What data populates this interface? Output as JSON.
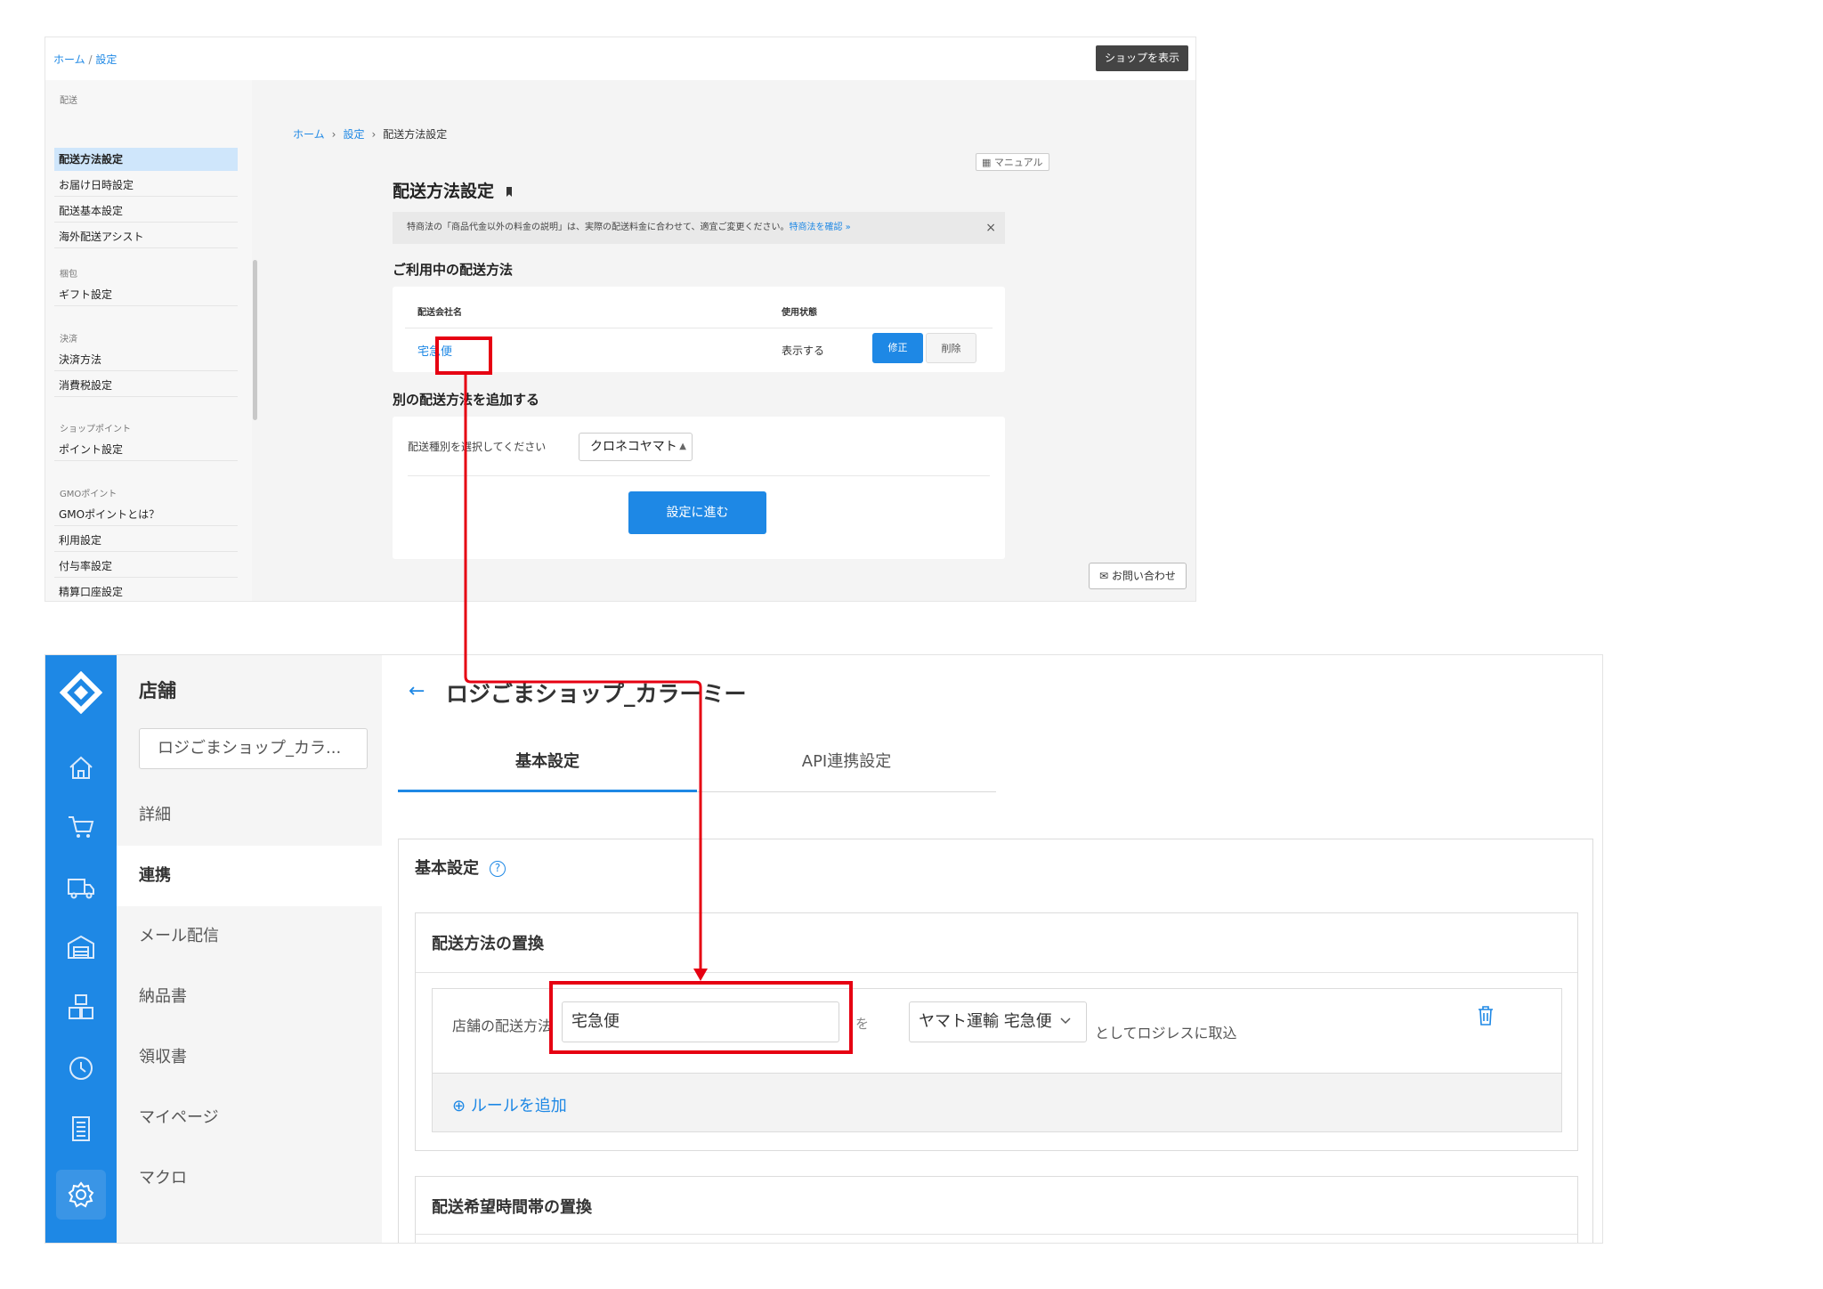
{
  "shop_settings": {
    "topbar": {
      "crumb_home": "ホーム",
      "crumb_sep": "/",
      "crumb_current": "設定",
      "show_shop_button": "ショップを表示"
    },
    "sidebar": {
      "groups": [
        {
          "title": "配送",
          "items": [
            "配送方法設定",
            "お届け日時設定",
            "配送基本設定",
            "海外配送アシスト"
          ]
        },
        {
          "title": "梱包",
          "items": [
            "ギフト設定"
          ]
        },
        {
          "title": "決済",
          "items": [
            "決済方法",
            "消費税設定"
          ]
        },
        {
          "title": "ショップポイント",
          "items": [
            "ポイント設定"
          ]
        },
        {
          "title": "GMOポイント",
          "items": [
            "GMOポイントとは？",
            "利用設定",
            "付与率設定",
            "精算口座設定"
          ]
        }
      ],
      "active_item": "配送方法設定"
    },
    "breadcrumb": {
      "home": "ホーム",
      "sep": "›",
      "settings": "設定",
      "current": "配送方法設定"
    },
    "manual_button": "マニュアル",
    "page_title": "配送方法設定",
    "notice": {
      "text": "特商法の「商品代金以外の料金の説明」は、実際の配送料金に合わせて、適宜ご変更ください。",
      "link": "特商法を確認 »",
      "close": "×"
    },
    "in_use": {
      "heading": "ご利用中の配送方法",
      "col_carrier": "配送会社名",
      "col_status": "使用状態",
      "row": {
        "carrier": "宅急便",
        "status": "表示する",
        "edit": "修正",
        "delete": "削除"
      }
    },
    "add_method": {
      "heading": "別の配送方法を追加する",
      "label": "配送種別を選択してください",
      "selected": "クロネコヤマト",
      "proceed_button": "設定に進む"
    },
    "contact_button": "お問い合わせ"
  },
  "logiless": {
    "side_heading": "店舗",
    "store_selector": "ロジごまショップ_カラ...",
    "nav": [
      "詳細",
      "連携",
      "メール配信",
      "納品書",
      "領収書",
      "マイページ",
      "マクロ"
    ],
    "active_nav": "連携",
    "rail_icons": [
      "logo-icon",
      "home-icon",
      "cart-icon",
      "truck-icon",
      "warehouse-icon",
      "boxes-icon",
      "history-icon",
      "ledger-icon",
      "settings-icon"
    ],
    "back_arrow": "←",
    "title": "ロジごまショップ_カラーミー",
    "tabs": [
      "基本設定",
      "API連携設定"
    ],
    "panel_heading": "基本設定",
    "help_glyph": "?",
    "section1_title": "配送方法の置換",
    "rule": {
      "label": "店舗の配送方法",
      "input_value": "宅急便",
      "particle": "を",
      "select_value": "ヤマト運輸 宅急便",
      "suffix": "としてロジレスに取込"
    },
    "add_rule": "ルールを追加",
    "section2_title": "配送希望時間帯の置換"
  },
  "colors": {
    "accent_blue": "#1e88e5",
    "annotation_red": "#e60012",
    "rail_blue": "#1e88e5"
  }
}
